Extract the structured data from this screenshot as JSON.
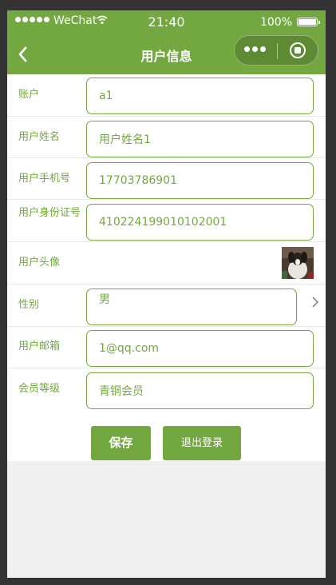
{
  "status_bar": {
    "carrier": "WeChat",
    "time": "21:40",
    "battery": "100%"
  },
  "nav": {
    "title": "用户信息"
  },
  "fields": [
    {
      "label": "账户",
      "value": "a1"
    },
    {
      "label": "用户姓名",
      "value": "用户姓名1"
    },
    {
      "label": "用户手机号",
      "value": "17703786901"
    },
    {
      "label": "用户身份证号",
      "value": "410224199010102001"
    },
    {
      "label": "用户头像"
    },
    {
      "label": "性别",
      "value": "男"
    },
    {
      "label": "用户邮箱",
      "value": "1@qq.com"
    },
    {
      "label": "会员等级",
      "value": "青铜会员"
    }
  ],
  "buttons": {
    "save": "保存",
    "logout": "退出登录"
  },
  "colors": {
    "accent": "#73a840",
    "background": "#f0f0f0"
  },
  "icons": [
    "back-arrow-icon",
    "wifi-icon",
    "battery-icon",
    "more-dots-icon",
    "close-circle-icon",
    "chevron-right-icon"
  ]
}
